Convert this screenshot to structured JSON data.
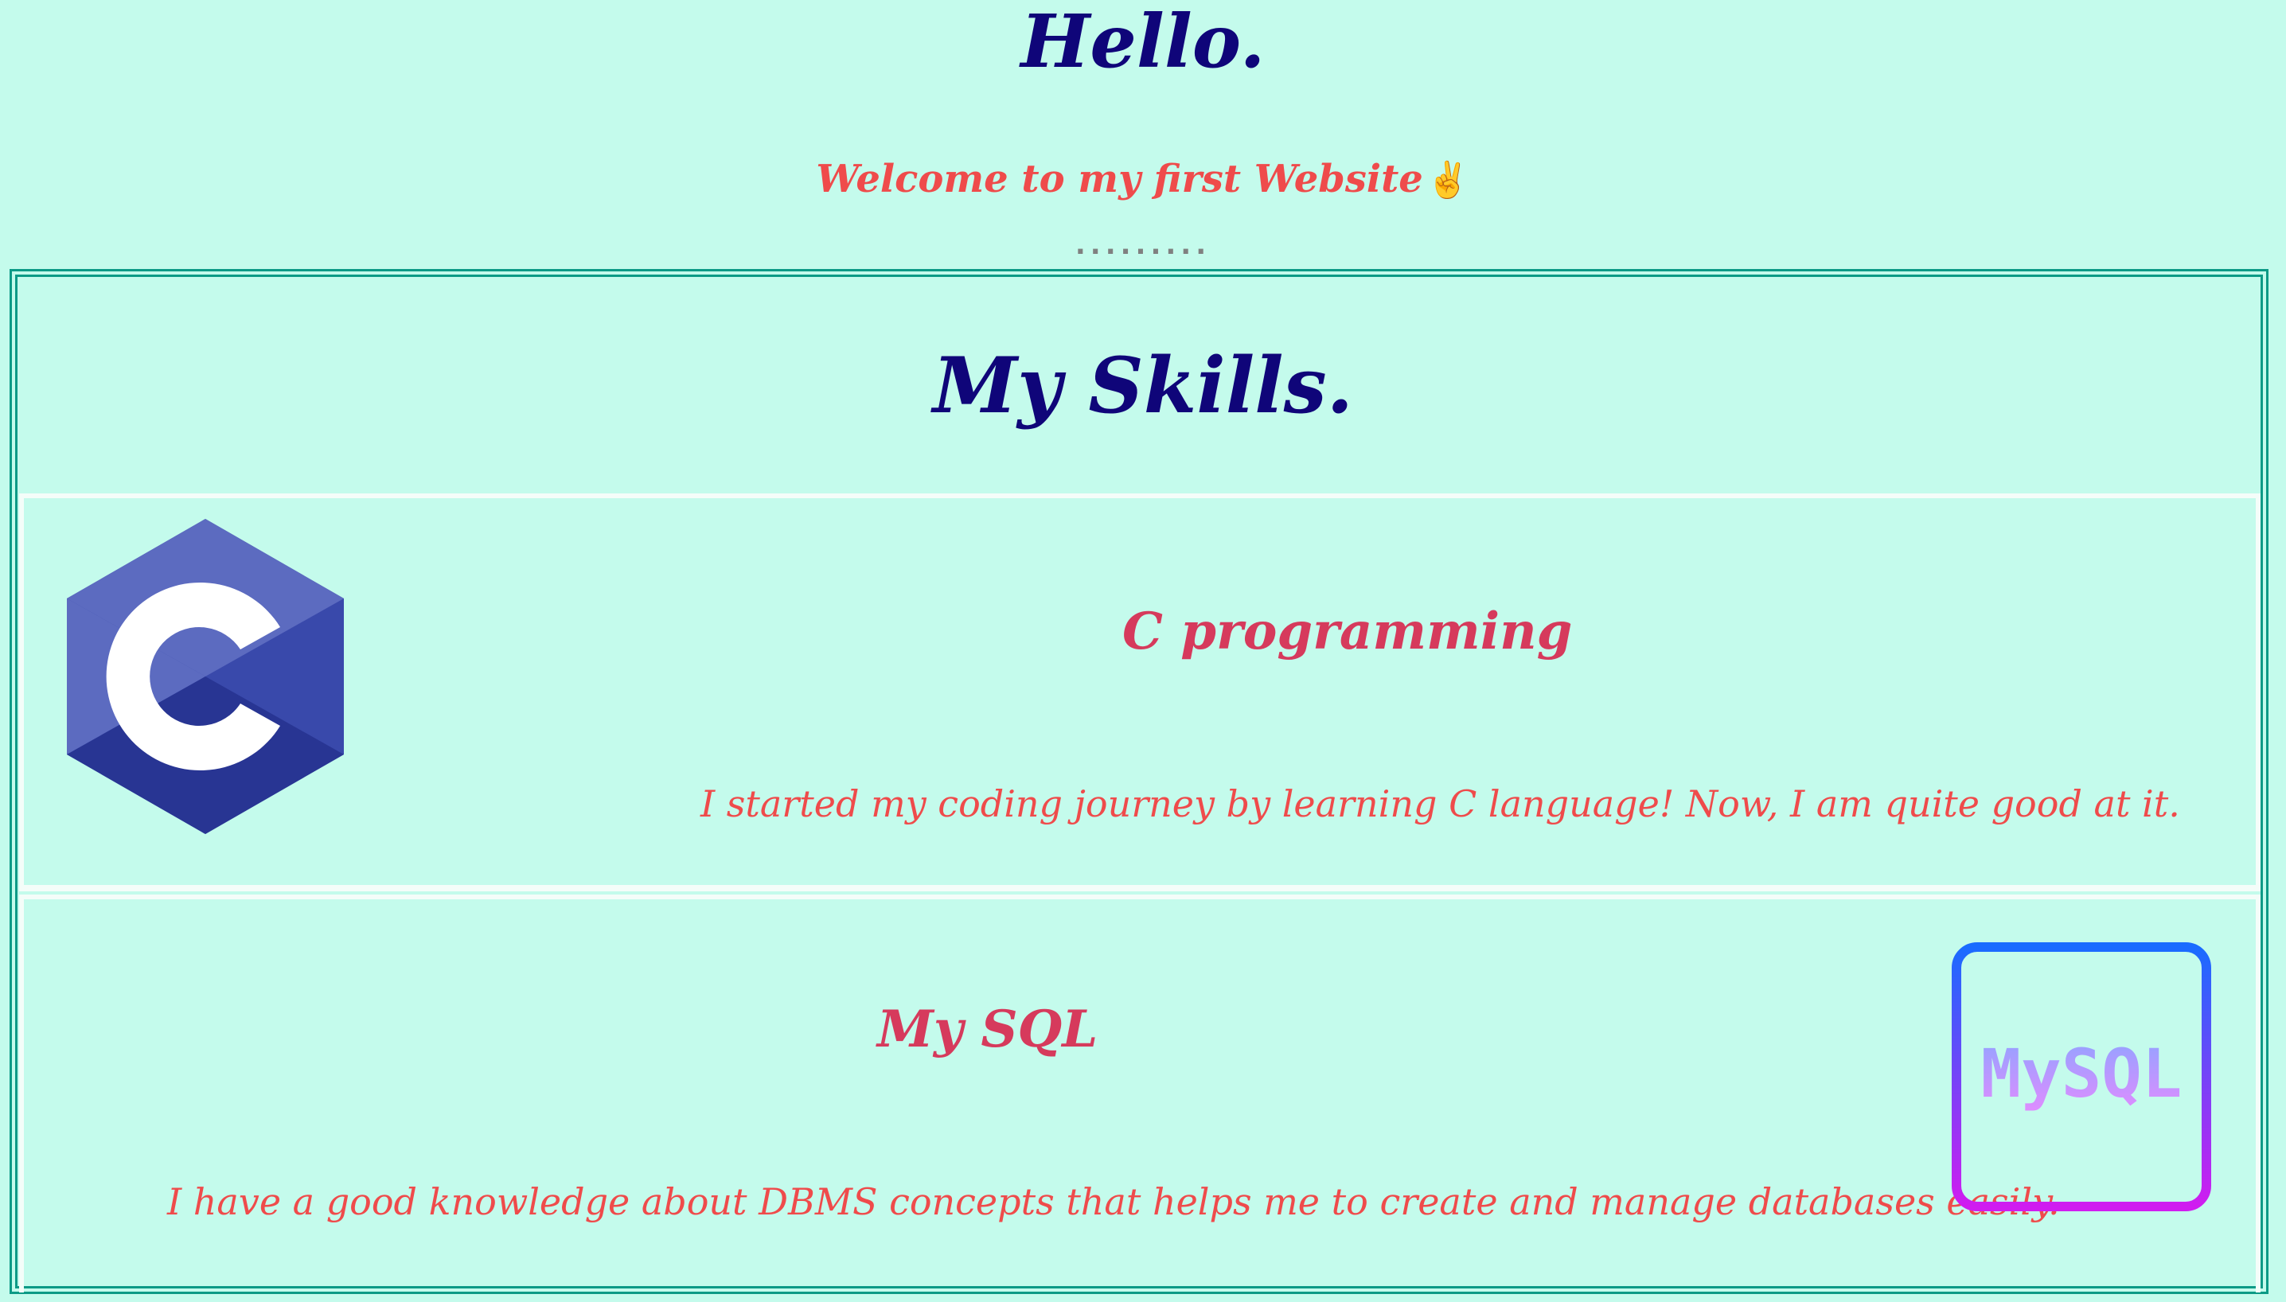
{
  "header": {
    "greeting": "Hello.",
    "welcome": "Welcome to my first Website",
    "welcome_emoji": "✌",
    "divider_dots": "........."
  },
  "skills": {
    "title": "My Skills.",
    "items": [
      {
        "heading": "C programming",
        "description": "I started my coding journey by learning C language! Now, I am quite good at it.",
        "logo_icon": "c-language-logo",
        "logo_text": "C"
      },
      {
        "heading": "My SQL",
        "description": "I have a good knowledge about DBMS concepts that helps me to create and manage databases easily.",
        "logo_icon": "mysql-logo",
        "logo_text": "MySQL"
      }
    ]
  },
  "colors": {
    "background": "#c4fbec",
    "heading_navy": "#0f0579",
    "accent_red": "#ef4b4b",
    "skill_heading_pink": "#d63a5c",
    "border_teal": "#0c9a86"
  }
}
